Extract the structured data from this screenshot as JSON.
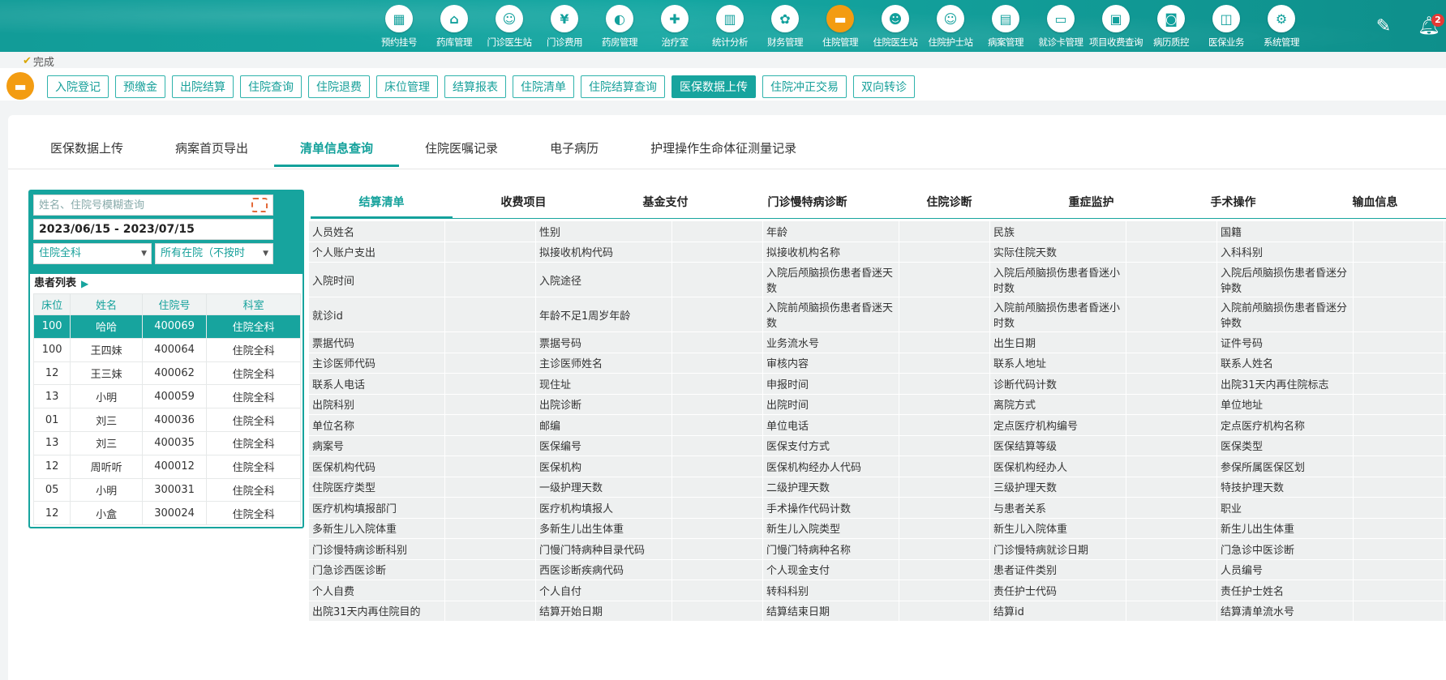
{
  "topnav": {
    "items": [
      {
        "label": "预约挂号",
        "icon": "calendar-icon",
        "glyph": "▦"
      },
      {
        "label": "药库管理",
        "icon": "warehouse-icon",
        "glyph": "⌂"
      },
      {
        "label": "门诊医生站",
        "icon": "doctor-icon",
        "glyph": "☺"
      },
      {
        "label": "门诊费用",
        "icon": "yen-icon",
        "glyph": "¥"
      },
      {
        "label": "药房管理",
        "icon": "pill-icon",
        "glyph": "◐"
      },
      {
        "label": "治疗室",
        "icon": "nurse-icon",
        "glyph": "✚"
      },
      {
        "label": "统计分析",
        "icon": "bar-chart-icon",
        "glyph": "▥"
      },
      {
        "label": "财务管理",
        "icon": "gear-coin-icon",
        "glyph": "✿"
      },
      {
        "label": "住院管理",
        "icon": "bed-icon",
        "glyph": "▬"
      },
      {
        "label": "住院医生站",
        "icon": "doctor-desk-icon",
        "glyph": "☻"
      },
      {
        "label": "住院护士站",
        "icon": "nurse-station-icon",
        "glyph": "☺"
      },
      {
        "label": "病案管理",
        "icon": "record-icon",
        "glyph": "▤"
      },
      {
        "label": "就诊卡管理",
        "icon": "card-icon",
        "glyph": "▭"
      },
      {
        "label": "项目收费查询",
        "icon": "fee-query-icon",
        "glyph": "▣"
      },
      {
        "label": "病历质控",
        "icon": "quality-icon",
        "glyph": "◙"
      },
      {
        "label": "医保业务",
        "icon": "insurance-icon",
        "glyph": "◫"
      },
      {
        "label": "系统管理",
        "icon": "settings-icon",
        "glyph": "⚙"
      }
    ],
    "active_index": 8,
    "notification_count": "2"
  },
  "status": {
    "text": "完成",
    "icon": "checkmark-icon"
  },
  "toolbar": {
    "buttons": [
      "入院登记",
      "预缴金",
      "出院结算",
      "住院查询",
      "住院退费",
      "床位管理",
      "结算报表",
      "住院清单",
      "住院结算查询",
      "医保数据上传",
      "住院冲正交易",
      "双向转诊"
    ],
    "active_index": 9
  },
  "main_tabs": {
    "items": [
      "医保数据上传",
      "病案首页导出",
      "清单信息查询",
      "住院医嘱记录",
      "电子病历",
      "护理操作生命体征测量记录"
    ],
    "active_index": 2
  },
  "patient_panel": {
    "search_placeholder": "姓名、住院号模糊查询",
    "date_range": "2023/06/15 - 2023/07/15",
    "dept_select": "住院全科",
    "status_select": "所有在院（不按时",
    "list_title": "患者列表",
    "columns": [
      "床位",
      "姓名",
      "住院号",
      "科室"
    ],
    "rows": [
      [
        "100",
        "哈哈",
        "400069",
        "住院全科"
      ],
      [
        "100",
        "王四妹",
        "400064",
        "住院全科"
      ],
      [
        "12",
        "王三妹",
        "400062",
        "住院全科"
      ],
      [
        "13",
        "小明",
        "400059",
        "住院全科"
      ],
      [
        "01",
        "刘三",
        "400036",
        "住院全科"
      ],
      [
        "13",
        "刘三",
        "400035",
        "住院全科"
      ],
      [
        "12",
        "周听听",
        "400012",
        "住院全科"
      ],
      [
        "05",
        "小明",
        "300031",
        "住院全科"
      ],
      [
        "12",
        "小盒",
        "300024",
        "住院全科"
      ]
    ],
    "selected_row": 0
  },
  "detail_tabs": {
    "items": [
      "结算清单",
      "收费项目",
      "基金支付",
      "门诊慢特病诊断",
      "住院诊断",
      "重症监护",
      "手术操作",
      "输血信息"
    ],
    "active_index": 0
  },
  "settlement_fields": [
    [
      "人员姓名",
      "性别",
      "年龄",
      "民族",
      "国籍"
    ],
    [
      "个人账户支出",
      "拟接收机构代码",
      "拟接收机构名称",
      "实际住院天数",
      "入科科别"
    ],
    [
      "入院时间",
      "入院途径",
      "入院后颅脑损伤患者昏迷天数",
      "入院后颅脑损伤患者昏迷小时数",
      "入院后颅脑损伤患者昏迷分钟数"
    ],
    [
      "就诊id",
      "年龄不足1周岁年龄",
      "入院前颅脑损伤患者昏迷天数",
      "入院前颅脑损伤患者昏迷小时数",
      "入院前颅脑损伤患者昏迷分钟数"
    ],
    [
      "票据代码",
      "票据号码",
      "业务流水号",
      "出生日期",
      "证件号码"
    ],
    [
      "主诊医师代码",
      "主诊医师姓名",
      "审核内容",
      "联系人地址",
      "联系人姓名"
    ],
    [
      "联系人电话",
      "现住址",
      "申报时间",
      "诊断代码计数",
      "出院31天内再住院标志"
    ],
    [
      "出院科别",
      "出院诊断",
      "出院时间",
      "离院方式",
      "单位地址"
    ],
    [
      "单位名称",
      "邮编",
      "单位电话",
      "定点医疗机构编号",
      "定点医疗机构名称"
    ],
    [
      "病案号",
      "医保编号",
      "医保支付方式",
      "医保结算等级",
      "医保类型"
    ],
    [
      "医保机构代码",
      "医保机构",
      "医保机构经办人代码",
      "医保机构经办人",
      "参保所属医保区划"
    ],
    [
      "住院医疗类型",
      "一级护理天数",
      "二级护理天数",
      "三级护理天数",
      "特技护理天数"
    ],
    [
      "医疗机构填报部门",
      "医疗机构填报人",
      "手术操作代码计数",
      "与患者关系",
      "职业"
    ],
    [
      "多新生儿入院体重",
      "多新生儿出生体重",
      "新生儿入院类型",
      "新生儿入院体重",
      "新生儿出生体重"
    ],
    [
      "门诊慢特病诊断科别",
      "门慢门特病种目录代码",
      "门慢门特病种名称",
      "门诊慢特病就诊日期",
      "门急诊中医诊断"
    ],
    [
      "门急诊西医诊断",
      "西医诊断疾病代码",
      "个人现金支付",
      "患者证件类别",
      "人员编号"
    ],
    [
      "个人自费",
      "个人自付",
      "转科科别",
      "责任护士代码",
      "责任护士姓名"
    ],
    [
      "出院31天内再住院目的",
      "结算开始日期",
      "结算结束日期",
      "结算id",
      "结算清单流水号"
    ]
  ]
}
